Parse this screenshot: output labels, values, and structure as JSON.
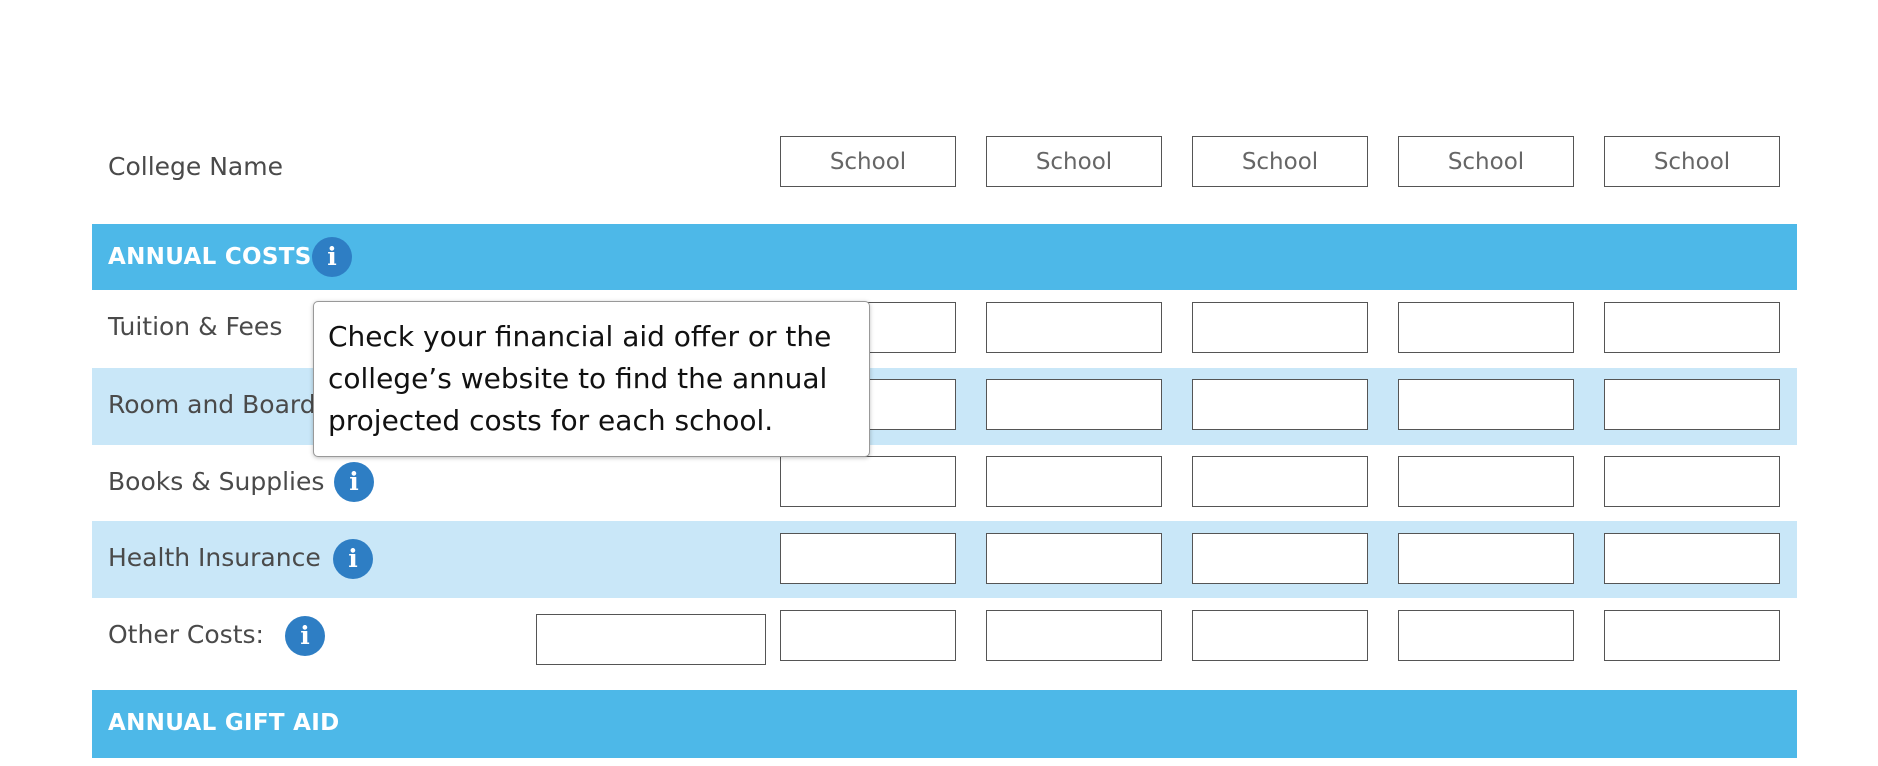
{
  "header_row": {
    "label": "College Name",
    "school_placeholders": [
      "School",
      "School",
      "School",
      "School",
      "School"
    ]
  },
  "annual_costs": {
    "title": "ANNUAL COSTS",
    "info_icon": "info-icon",
    "rows": [
      {
        "label": "Tuition & Fees"
      },
      {
        "label": "Room and Board"
      },
      {
        "label": "Books & Supplies"
      },
      {
        "label": "Health Insurance"
      },
      {
        "label": "Other Costs:"
      }
    ]
  },
  "tooltip": {
    "text": "Check your financial aid offer or the college’s website to find the annual projected costs for each school."
  },
  "annual_gift_aid": {
    "title": "ANNUAL GIFT AID"
  },
  "colors": {
    "section_band": "#4db8e8",
    "row_stripe": "#c9e7f8",
    "info_icon": "#2e7ec4"
  }
}
